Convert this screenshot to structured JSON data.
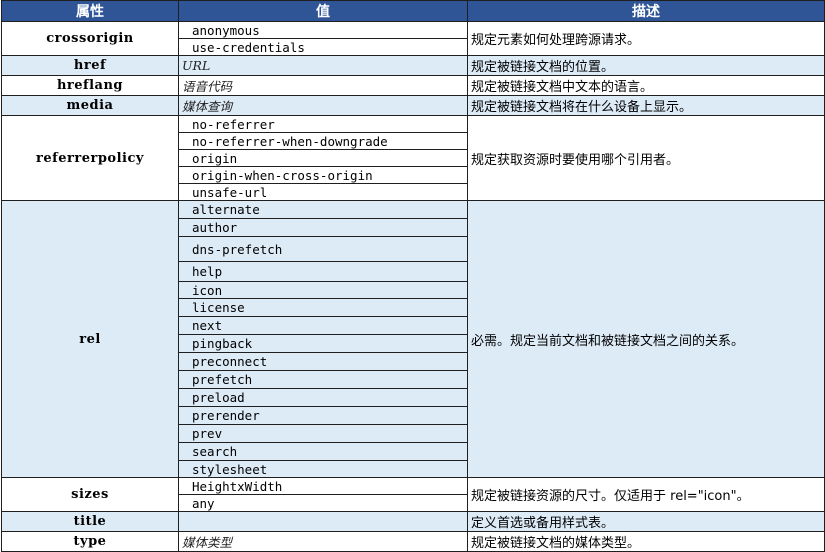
{
  "headers": {
    "attr": "属性",
    "value": "值",
    "desc": "描述"
  },
  "colors": {
    "header_bg": "#2F5597",
    "alt_row_bg": "#DDEBF7"
  },
  "rows": [
    {
      "attr": "crossorigin",
      "values": [
        "anonymous",
        "use-credentials"
      ],
      "desc": "规定元素如何处理跨源请求。",
      "italic": false,
      "blue": false
    },
    {
      "attr": "href",
      "values": [
        "URL"
      ],
      "desc": "规定被链接文档的位置。",
      "italic": true,
      "blue": true
    },
    {
      "attr": "hreflang",
      "values": [
        "语音代码"
      ],
      "desc": "规定被链接文档中文本的语言。",
      "italic": true,
      "blue": false
    },
    {
      "attr": "media",
      "values": [
        "媒体查询"
      ],
      "desc": "规定被链接文档将在什么设备上显示。",
      "italic": true,
      "blue": true
    },
    {
      "attr": "referrerpolicy",
      "values": [
        "no-referrer",
        "no-referrer-when-downgrade",
        "origin",
        "origin-when-cross-origin",
        "unsafe-url"
      ],
      "desc": "规定获取资源时要使用哪个引用者。",
      "italic": false,
      "blue": false
    },
    {
      "attr": "rel",
      "values": [
        "alternate",
        "author",
        "dns-prefetch",
        "help",
        "icon",
        "license",
        "next",
        "pingback",
        "preconnect",
        "prefetch",
        "preload",
        "prerender",
        "prev",
        "search",
        "stylesheet"
      ],
      "desc": "必需。规定当前文档和被链接文档之间的关系。",
      "italic": false,
      "blue": true
    },
    {
      "attr": "sizes",
      "values": [
        "HeightxWidth",
        "any"
      ],
      "desc": "规定被链接资源的尺寸。仅适用于 rel=\"icon\"。",
      "italic": false,
      "blue": false
    },
    {
      "attr": "title",
      "values": [
        ""
      ],
      "desc": "定义首选或备用样式表。",
      "italic": false,
      "blue": true
    },
    {
      "attr": "type",
      "values": [
        "媒体类型"
      ],
      "desc": "规定被链接文档的媒体类型。",
      "italic": true,
      "blue": false
    }
  ]
}
